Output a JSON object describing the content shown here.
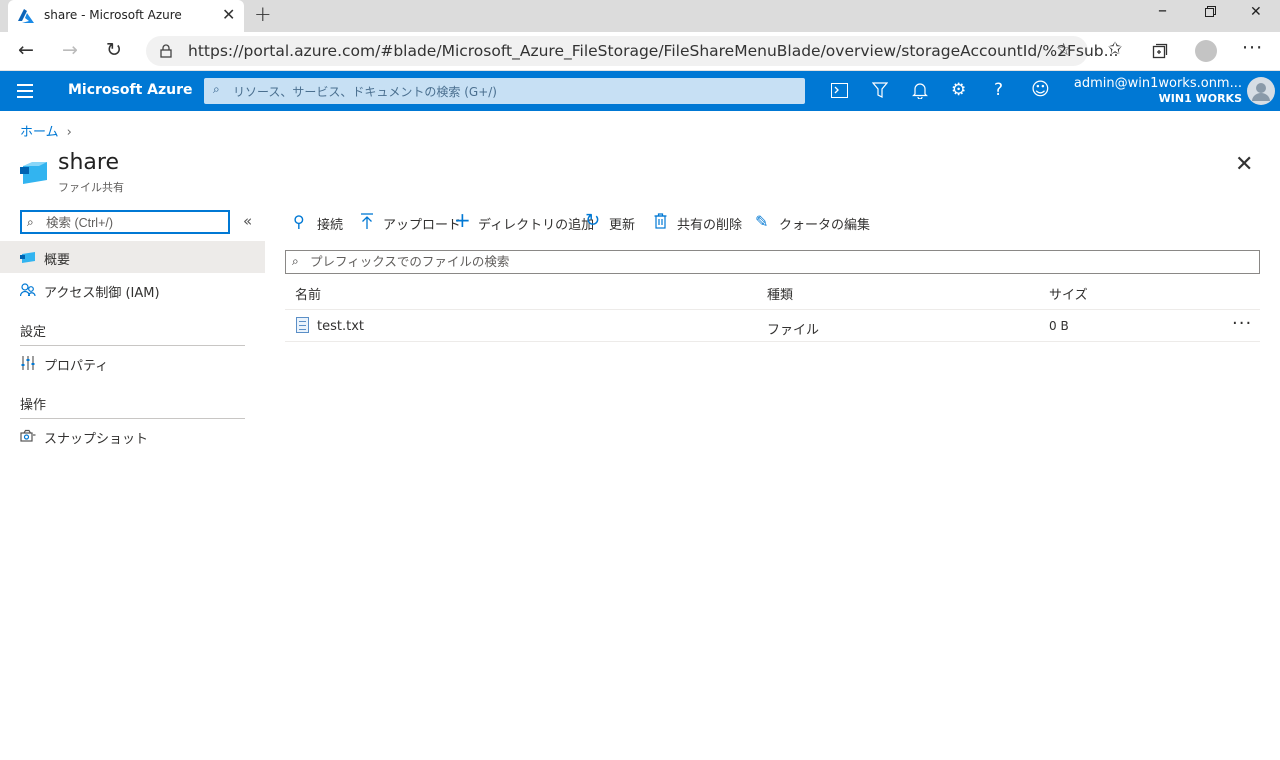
{
  "browser": {
    "tab_title": "share - Microsoft Azure",
    "url": "https://portal.azure.com/#blade/Microsoft_Azure_FileStorage/FileShareMenuBlade/overview/storageAccountId/%2Fsub..."
  },
  "header": {
    "brand": "Microsoft Azure",
    "search_placeholder": "リソース、サービス、ドキュメントの検索 (G+/)",
    "account_name": "admin@win1works.onm...",
    "org": "WIN1 WORKS",
    "accent_color": "#0078d4"
  },
  "breadcrumb": {
    "home": "ホーム"
  },
  "blade": {
    "title": "share",
    "subtitle": "ファイル共有"
  },
  "menu": {
    "search_placeholder": "検索 (Ctrl+/)",
    "items": {
      "overview": "概要",
      "iam": "アクセス制御 (IAM)",
      "properties": "プロパティ",
      "snapshots": "スナップショット"
    },
    "sections": {
      "settings": "設定",
      "operations": "操作"
    }
  },
  "commands": {
    "connect": "接続",
    "upload": "アップロード",
    "add_directory": "ディレクトリの追加",
    "refresh": "更新",
    "delete_share": "共有の削除",
    "edit_quota": "クォータの編集"
  },
  "files": {
    "search_placeholder": "プレフィックスでのファイルの検索",
    "columns": {
      "name": "名前",
      "type": "種類",
      "size": "サイズ"
    },
    "rows": [
      {
        "name": "test.txt",
        "type": "ファイル",
        "size": "0 B"
      }
    ]
  }
}
